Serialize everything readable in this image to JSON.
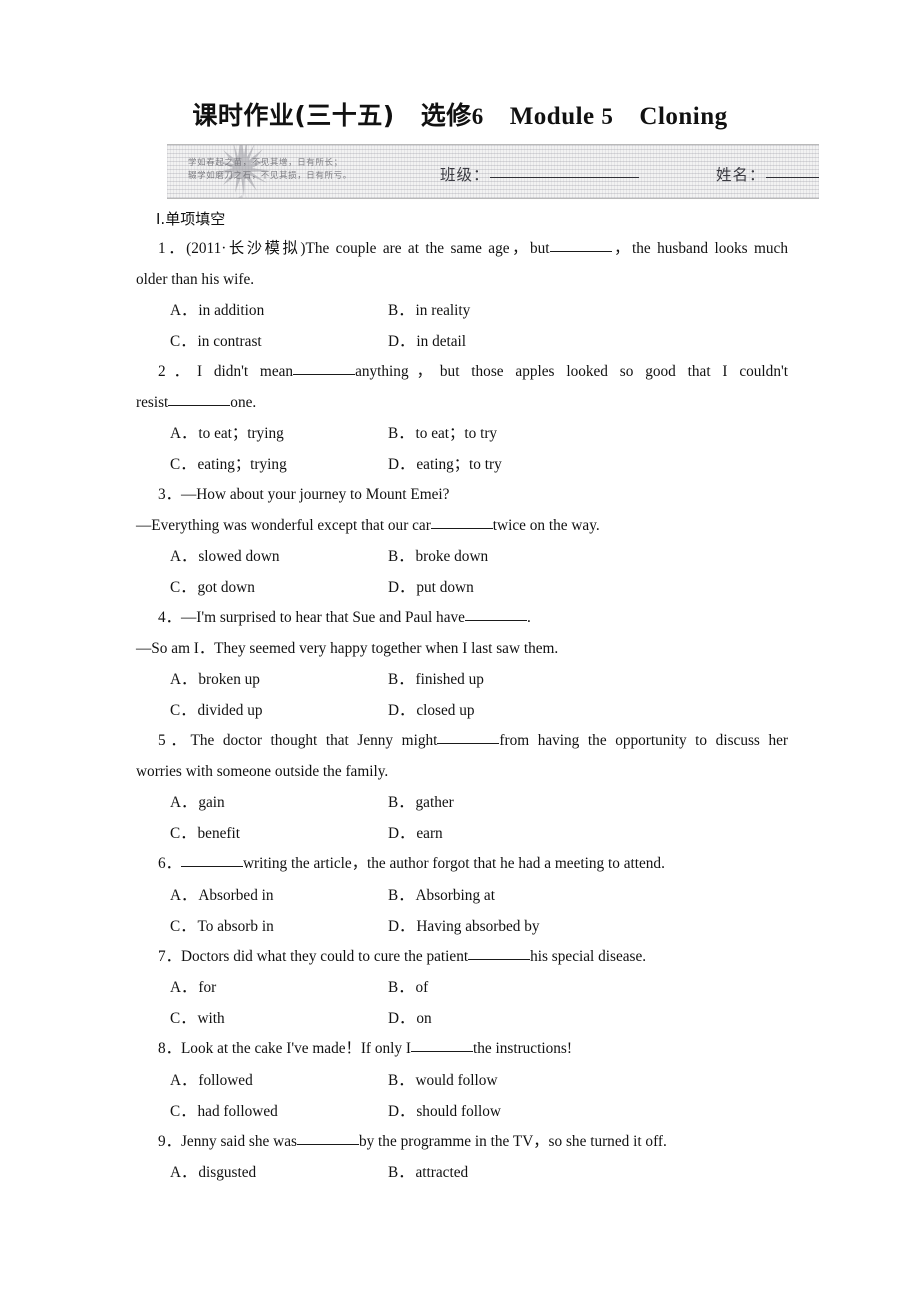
{
  "document": {
    "title": {
      "cn_prefix": "课时作业(三十五)",
      "elective": "选修",
      "elective_num": "6",
      "module": "Module",
      "module_num": "5",
      "unit": "Cloning"
    },
    "infobox": {
      "motto_line1": "学如春起之苗，不见其增，日有所长；",
      "motto_line2": "辍学如磨刀之石，不见其损，日有所亏。",
      "class_label": "班级：",
      "name_label": "姓名：",
      "sparkle_icon": "sparkle-icon"
    },
    "section": {
      "heading": "Ⅰ.单项填空"
    },
    "questions": [
      {
        "number": "1．",
        "source": "(2011·长沙模拟)",
        "stem_part1": "The couple are at the same age，but",
        "stem_part2": "，the husband looks much",
        "stem_line2": "older than his wife.",
        "options": [
          {
            "key": "A．",
            "text": "in addition"
          },
          {
            "key": "B．",
            "text": "in reality"
          },
          {
            "key": "C．",
            "text": "in contrast"
          },
          {
            "key": "D．",
            "text": "in detail"
          }
        ]
      },
      {
        "number": "2．",
        "stem_part1": "I didn't mean",
        "stem_part2": "anything，but those apples looked so good that I couldn't",
        "stem_line2_a": "resist",
        "stem_line2_b": "one.",
        "options": [
          {
            "key": "A．",
            "text": "to eat；trying"
          },
          {
            "key": "B．",
            "text": "to eat；to try"
          },
          {
            "key": "C．",
            "text": "eating；trying"
          },
          {
            "key": "D．",
            "text": "eating；to try"
          }
        ]
      },
      {
        "number": "3．",
        "stem_line1": "—How about your journey to Mount Emei?",
        "stem_line2_a": "—Everything was wonderful except that our car",
        "stem_line2_b": "twice on the way.",
        "options": [
          {
            "key": "A．",
            "text": "slowed down"
          },
          {
            "key": "B．",
            "text": "broke down"
          },
          {
            "key": "C．",
            "text": "got down"
          },
          {
            "key": "D．",
            "text": "put down"
          }
        ]
      },
      {
        "number": "4．",
        "stem_line1_a": "—I'm surprised to hear that Sue and Paul have",
        "stem_line1_b": ".",
        "stem_line2": "—So am I．They seemed very happy together when I last saw them.",
        "options": [
          {
            "key": "A．",
            "text": "broken up"
          },
          {
            "key": "B．",
            "text": "finished up"
          },
          {
            "key": "C．",
            "text": "divided up"
          },
          {
            "key": "D．",
            "text": "closed up"
          }
        ]
      },
      {
        "number": "5．",
        "stem_part1": "The doctor thought that Jenny might",
        "stem_part2": "from having the opportunity to discuss her",
        "stem_line2": "worries with someone outside the family.",
        "options": [
          {
            "key": "A．",
            "text": "gain"
          },
          {
            "key": "B．",
            "text": "gather"
          },
          {
            "key": "C．",
            "text": "benefit"
          },
          {
            "key": "D．",
            "text": "earn"
          }
        ]
      },
      {
        "number": "6．",
        "stem_part1": "",
        "stem_part2": "writing the article，the author forgot that he had a meeting to attend.",
        "options": [
          {
            "key": "A．",
            "text": "Absorbed in"
          },
          {
            "key": "B．",
            "text": "Absorbing at"
          },
          {
            "key": "C．",
            "text": "To absorb in"
          },
          {
            "key": "D．",
            "text": "Having absorbed by"
          }
        ]
      },
      {
        "number": "7．",
        "stem_part1": "Doctors did what they could to cure the patient",
        "stem_part2": "his special disease.",
        "options": [
          {
            "key": "A．",
            "text": "for"
          },
          {
            "key": "B．",
            "text": "of"
          },
          {
            "key": "C．",
            "text": "with"
          },
          {
            "key": "D．",
            "text": "on"
          }
        ]
      },
      {
        "number": "8．",
        "stem_part1": "Look at the cake I've made！If only I",
        "stem_part2": "the instructions!",
        "options": [
          {
            "key": "A．",
            "text": "followed"
          },
          {
            "key": "B．",
            "text": "would follow"
          },
          {
            "key": "C．",
            "text": "had followed"
          },
          {
            "key": "D．",
            "text": "should follow"
          }
        ]
      },
      {
        "number": "9．",
        "stem_part1": "Jenny said she was",
        "stem_part2": "by the programme in the TV，so she turned it off.",
        "options": [
          {
            "key": "A．",
            "text": "disgusted"
          },
          {
            "key": "B．",
            "text": "attracted"
          }
        ]
      }
    ]
  }
}
